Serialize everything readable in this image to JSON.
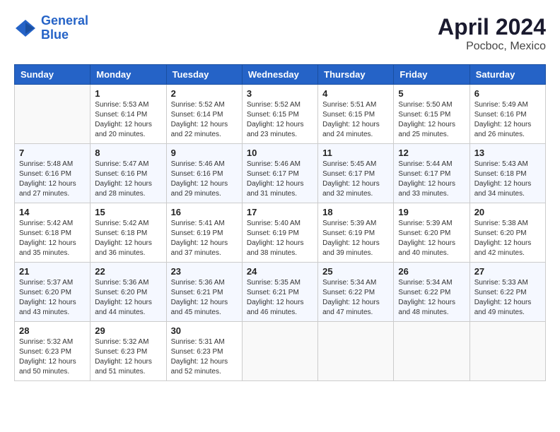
{
  "header": {
    "logo_line1": "General",
    "logo_line2": "Blue",
    "title": "April 2024",
    "subtitle": "Pocboc, Mexico"
  },
  "days_of_week": [
    "Sunday",
    "Monday",
    "Tuesday",
    "Wednesday",
    "Thursday",
    "Friday",
    "Saturday"
  ],
  "weeks": [
    [
      {
        "day": "",
        "info": ""
      },
      {
        "day": "1",
        "info": "Sunrise: 5:53 AM\nSunset: 6:14 PM\nDaylight: 12 hours\nand 20 minutes."
      },
      {
        "day": "2",
        "info": "Sunrise: 5:52 AM\nSunset: 6:14 PM\nDaylight: 12 hours\nand 22 minutes."
      },
      {
        "day": "3",
        "info": "Sunrise: 5:52 AM\nSunset: 6:15 PM\nDaylight: 12 hours\nand 23 minutes."
      },
      {
        "day": "4",
        "info": "Sunrise: 5:51 AM\nSunset: 6:15 PM\nDaylight: 12 hours\nand 24 minutes."
      },
      {
        "day": "5",
        "info": "Sunrise: 5:50 AM\nSunset: 6:15 PM\nDaylight: 12 hours\nand 25 minutes."
      },
      {
        "day": "6",
        "info": "Sunrise: 5:49 AM\nSunset: 6:16 PM\nDaylight: 12 hours\nand 26 minutes."
      }
    ],
    [
      {
        "day": "7",
        "info": "Sunrise: 5:48 AM\nSunset: 6:16 PM\nDaylight: 12 hours\nand 27 minutes."
      },
      {
        "day": "8",
        "info": "Sunrise: 5:47 AM\nSunset: 6:16 PM\nDaylight: 12 hours\nand 28 minutes."
      },
      {
        "day": "9",
        "info": "Sunrise: 5:46 AM\nSunset: 6:16 PM\nDaylight: 12 hours\nand 29 minutes."
      },
      {
        "day": "10",
        "info": "Sunrise: 5:46 AM\nSunset: 6:17 PM\nDaylight: 12 hours\nand 31 minutes."
      },
      {
        "day": "11",
        "info": "Sunrise: 5:45 AM\nSunset: 6:17 PM\nDaylight: 12 hours\nand 32 minutes."
      },
      {
        "day": "12",
        "info": "Sunrise: 5:44 AM\nSunset: 6:17 PM\nDaylight: 12 hours\nand 33 minutes."
      },
      {
        "day": "13",
        "info": "Sunrise: 5:43 AM\nSunset: 6:18 PM\nDaylight: 12 hours\nand 34 minutes."
      }
    ],
    [
      {
        "day": "14",
        "info": "Sunrise: 5:42 AM\nSunset: 6:18 PM\nDaylight: 12 hours\nand 35 minutes."
      },
      {
        "day": "15",
        "info": "Sunrise: 5:42 AM\nSunset: 6:18 PM\nDaylight: 12 hours\nand 36 minutes."
      },
      {
        "day": "16",
        "info": "Sunrise: 5:41 AM\nSunset: 6:19 PM\nDaylight: 12 hours\nand 37 minutes."
      },
      {
        "day": "17",
        "info": "Sunrise: 5:40 AM\nSunset: 6:19 PM\nDaylight: 12 hours\nand 38 minutes."
      },
      {
        "day": "18",
        "info": "Sunrise: 5:39 AM\nSunset: 6:19 PM\nDaylight: 12 hours\nand 39 minutes."
      },
      {
        "day": "19",
        "info": "Sunrise: 5:39 AM\nSunset: 6:20 PM\nDaylight: 12 hours\nand 40 minutes."
      },
      {
        "day": "20",
        "info": "Sunrise: 5:38 AM\nSunset: 6:20 PM\nDaylight: 12 hours\nand 42 minutes."
      }
    ],
    [
      {
        "day": "21",
        "info": "Sunrise: 5:37 AM\nSunset: 6:20 PM\nDaylight: 12 hours\nand 43 minutes."
      },
      {
        "day": "22",
        "info": "Sunrise: 5:36 AM\nSunset: 6:20 PM\nDaylight: 12 hours\nand 44 minutes."
      },
      {
        "day": "23",
        "info": "Sunrise: 5:36 AM\nSunset: 6:21 PM\nDaylight: 12 hours\nand 45 minutes."
      },
      {
        "day": "24",
        "info": "Sunrise: 5:35 AM\nSunset: 6:21 PM\nDaylight: 12 hours\nand 46 minutes."
      },
      {
        "day": "25",
        "info": "Sunrise: 5:34 AM\nSunset: 6:22 PM\nDaylight: 12 hours\nand 47 minutes."
      },
      {
        "day": "26",
        "info": "Sunrise: 5:34 AM\nSunset: 6:22 PM\nDaylight: 12 hours\nand 48 minutes."
      },
      {
        "day": "27",
        "info": "Sunrise: 5:33 AM\nSunset: 6:22 PM\nDaylight: 12 hours\nand 49 minutes."
      }
    ],
    [
      {
        "day": "28",
        "info": "Sunrise: 5:32 AM\nSunset: 6:23 PM\nDaylight: 12 hours\nand 50 minutes."
      },
      {
        "day": "29",
        "info": "Sunrise: 5:32 AM\nSunset: 6:23 PM\nDaylight: 12 hours\nand 51 minutes."
      },
      {
        "day": "30",
        "info": "Sunrise: 5:31 AM\nSunset: 6:23 PM\nDaylight: 12 hours\nand 52 minutes."
      },
      {
        "day": "",
        "info": ""
      },
      {
        "day": "",
        "info": ""
      },
      {
        "day": "",
        "info": ""
      },
      {
        "day": "",
        "info": ""
      }
    ]
  ]
}
